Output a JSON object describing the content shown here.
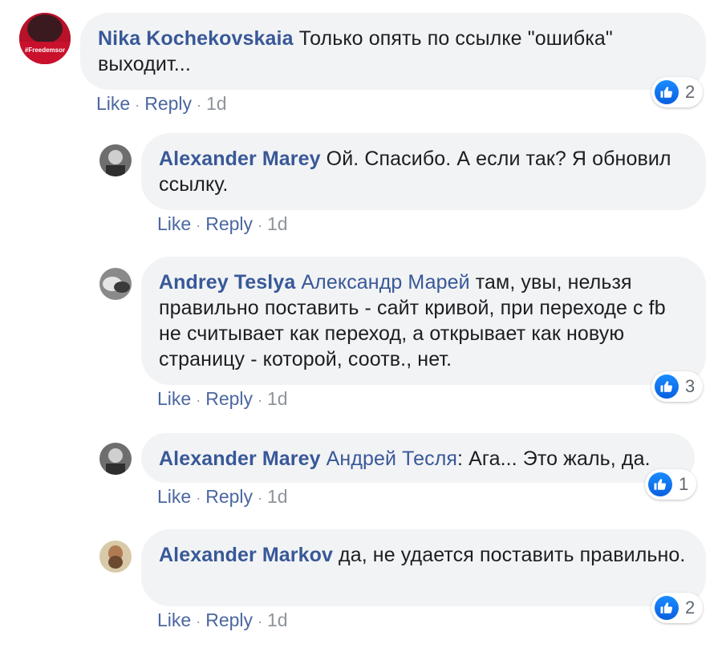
{
  "actions": {
    "like": "Like",
    "reply": "Reply",
    "sep": "·"
  },
  "comments": [
    {
      "author": "Nika Kochekovskaia",
      "mention": "",
      "text": " Только опять по ссылке \"ошибка\" выходит...",
      "time": "1d",
      "likes": "2",
      "avatar_text": "#Freedemsor"
    },
    {
      "author": "Alexander Marey",
      "mention": "",
      "text": " Ой. Спасибо. А если так? Я обновил ссылку.",
      "time": "1d",
      "likes": ""
    },
    {
      "author": "Andrey Teslya",
      "mention": "Александр Марей",
      "text": " там, увы, нельзя правильно поставить - сайт кривой, при переходе с fb не считывает как переход, а открывает как новую страницу - которой, соотв., нет.",
      "time": "1d",
      "likes": "3"
    },
    {
      "author": "Alexander Marey",
      "mention": "Андрей Тесля",
      "text": ": Ага... Это жаль, да.",
      "time": "1d",
      "likes": "1"
    },
    {
      "author": "Alexander Markov",
      "mention": "",
      "text": " да, не удается поставить правильно.",
      "time": "1d",
      "likes": "2"
    }
  ],
  "colors": {
    "author": "#385898",
    "bubble": "#f2f3f5",
    "like": "#1877f2"
  }
}
